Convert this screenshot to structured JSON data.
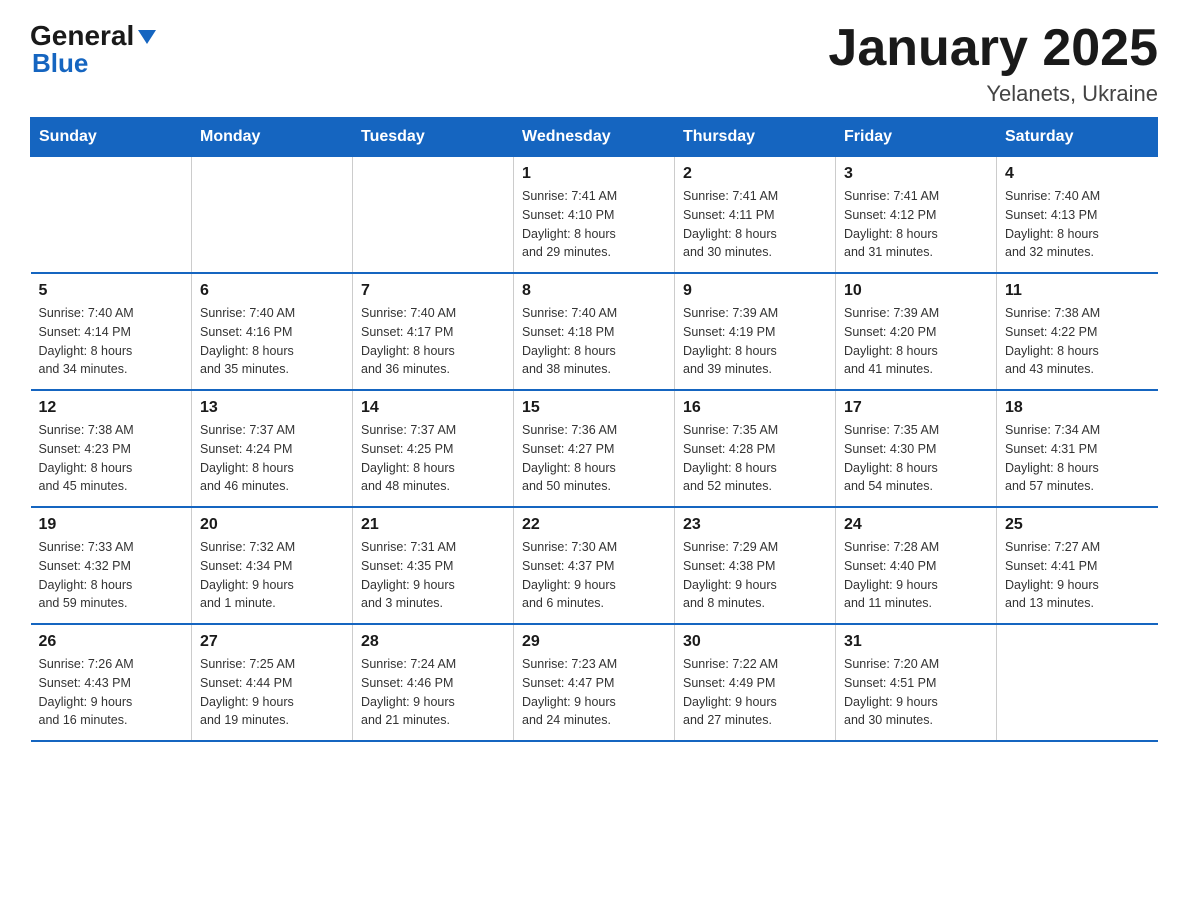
{
  "header": {
    "logo_general": "General",
    "logo_blue": "Blue",
    "title": "January 2025",
    "subtitle": "Yelanets, Ukraine"
  },
  "days_of_week": [
    "Sunday",
    "Monday",
    "Tuesday",
    "Wednesday",
    "Thursday",
    "Friday",
    "Saturday"
  ],
  "weeks": [
    [
      {
        "day": "",
        "info": ""
      },
      {
        "day": "",
        "info": ""
      },
      {
        "day": "",
        "info": ""
      },
      {
        "day": "1",
        "info": "Sunrise: 7:41 AM\nSunset: 4:10 PM\nDaylight: 8 hours\nand 29 minutes."
      },
      {
        "day": "2",
        "info": "Sunrise: 7:41 AM\nSunset: 4:11 PM\nDaylight: 8 hours\nand 30 minutes."
      },
      {
        "day": "3",
        "info": "Sunrise: 7:41 AM\nSunset: 4:12 PM\nDaylight: 8 hours\nand 31 minutes."
      },
      {
        "day": "4",
        "info": "Sunrise: 7:40 AM\nSunset: 4:13 PM\nDaylight: 8 hours\nand 32 minutes."
      }
    ],
    [
      {
        "day": "5",
        "info": "Sunrise: 7:40 AM\nSunset: 4:14 PM\nDaylight: 8 hours\nand 34 minutes."
      },
      {
        "day": "6",
        "info": "Sunrise: 7:40 AM\nSunset: 4:16 PM\nDaylight: 8 hours\nand 35 minutes."
      },
      {
        "day": "7",
        "info": "Sunrise: 7:40 AM\nSunset: 4:17 PM\nDaylight: 8 hours\nand 36 minutes."
      },
      {
        "day": "8",
        "info": "Sunrise: 7:40 AM\nSunset: 4:18 PM\nDaylight: 8 hours\nand 38 minutes."
      },
      {
        "day": "9",
        "info": "Sunrise: 7:39 AM\nSunset: 4:19 PM\nDaylight: 8 hours\nand 39 minutes."
      },
      {
        "day": "10",
        "info": "Sunrise: 7:39 AM\nSunset: 4:20 PM\nDaylight: 8 hours\nand 41 minutes."
      },
      {
        "day": "11",
        "info": "Sunrise: 7:38 AM\nSunset: 4:22 PM\nDaylight: 8 hours\nand 43 minutes."
      }
    ],
    [
      {
        "day": "12",
        "info": "Sunrise: 7:38 AM\nSunset: 4:23 PM\nDaylight: 8 hours\nand 45 minutes."
      },
      {
        "day": "13",
        "info": "Sunrise: 7:37 AM\nSunset: 4:24 PM\nDaylight: 8 hours\nand 46 minutes."
      },
      {
        "day": "14",
        "info": "Sunrise: 7:37 AM\nSunset: 4:25 PM\nDaylight: 8 hours\nand 48 minutes."
      },
      {
        "day": "15",
        "info": "Sunrise: 7:36 AM\nSunset: 4:27 PM\nDaylight: 8 hours\nand 50 minutes."
      },
      {
        "day": "16",
        "info": "Sunrise: 7:35 AM\nSunset: 4:28 PM\nDaylight: 8 hours\nand 52 minutes."
      },
      {
        "day": "17",
        "info": "Sunrise: 7:35 AM\nSunset: 4:30 PM\nDaylight: 8 hours\nand 54 minutes."
      },
      {
        "day": "18",
        "info": "Sunrise: 7:34 AM\nSunset: 4:31 PM\nDaylight: 8 hours\nand 57 minutes."
      }
    ],
    [
      {
        "day": "19",
        "info": "Sunrise: 7:33 AM\nSunset: 4:32 PM\nDaylight: 8 hours\nand 59 minutes."
      },
      {
        "day": "20",
        "info": "Sunrise: 7:32 AM\nSunset: 4:34 PM\nDaylight: 9 hours\nand 1 minute."
      },
      {
        "day": "21",
        "info": "Sunrise: 7:31 AM\nSunset: 4:35 PM\nDaylight: 9 hours\nand 3 minutes."
      },
      {
        "day": "22",
        "info": "Sunrise: 7:30 AM\nSunset: 4:37 PM\nDaylight: 9 hours\nand 6 minutes."
      },
      {
        "day": "23",
        "info": "Sunrise: 7:29 AM\nSunset: 4:38 PM\nDaylight: 9 hours\nand 8 minutes."
      },
      {
        "day": "24",
        "info": "Sunrise: 7:28 AM\nSunset: 4:40 PM\nDaylight: 9 hours\nand 11 minutes."
      },
      {
        "day": "25",
        "info": "Sunrise: 7:27 AM\nSunset: 4:41 PM\nDaylight: 9 hours\nand 13 minutes."
      }
    ],
    [
      {
        "day": "26",
        "info": "Sunrise: 7:26 AM\nSunset: 4:43 PM\nDaylight: 9 hours\nand 16 minutes."
      },
      {
        "day": "27",
        "info": "Sunrise: 7:25 AM\nSunset: 4:44 PM\nDaylight: 9 hours\nand 19 minutes."
      },
      {
        "day": "28",
        "info": "Sunrise: 7:24 AM\nSunset: 4:46 PM\nDaylight: 9 hours\nand 21 minutes."
      },
      {
        "day": "29",
        "info": "Sunrise: 7:23 AM\nSunset: 4:47 PM\nDaylight: 9 hours\nand 24 minutes."
      },
      {
        "day": "30",
        "info": "Sunrise: 7:22 AM\nSunset: 4:49 PM\nDaylight: 9 hours\nand 27 minutes."
      },
      {
        "day": "31",
        "info": "Sunrise: 7:20 AM\nSunset: 4:51 PM\nDaylight: 9 hours\nand 30 minutes."
      },
      {
        "day": "",
        "info": ""
      }
    ]
  ]
}
